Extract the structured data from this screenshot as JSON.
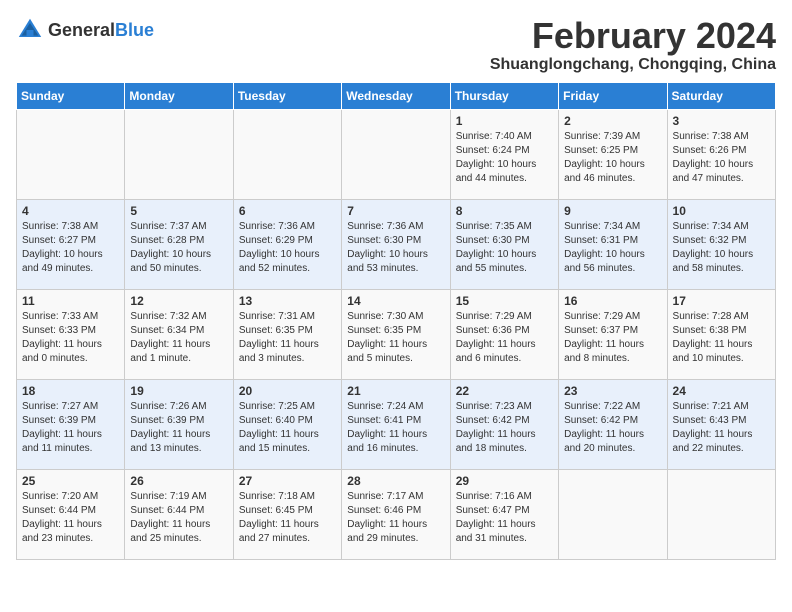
{
  "header": {
    "logo_general": "General",
    "logo_blue": "Blue",
    "title": "February 2024",
    "subtitle": "Shuanglongchang, Chongqing, China"
  },
  "days_of_week": [
    "Sunday",
    "Monday",
    "Tuesday",
    "Wednesday",
    "Thursday",
    "Friday",
    "Saturday"
  ],
  "weeks": [
    [
      {
        "day": "",
        "info": ""
      },
      {
        "day": "",
        "info": ""
      },
      {
        "day": "",
        "info": ""
      },
      {
        "day": "",
        "info": ""
      },
      {
        "day": "1",
        "info": "Sunrise: 7:40 AM\nSunset: 6:24 PM\nDaylight: 10 hours\nand 44 minutes."
      },
      {
        "day": "2",
        "info": "Sunrise: 7:39 AM\nSunset: 6:25 PM\nDaylight: 10 hours\nand 46 minutes."
      },
      {
        "day": "3",
        "info": "Sunrise: 7:38 AM\nSunset: 6:26 PM\nDaylight: 10 hours\nand 47 minutes."
      }
    ],
    [
      {
        "day": "4",
        "info": "Sunrise: 7:38 AM\nSunset: 6:27 PM\nDaylight: 10 hours\nand 49 minutes."
      },
      {
        "day": "5",
        "info": "Sunrise: 7:37 AM\nSunset: 6:28 PM\nDaylight: 10 hours\nand 50 minutes."
      },
      {
        "day": "6",
        "info": "Sunrise: 7:36 AM\nSunset: 6:29 PM\nDaylight: 10 hours\nand 52 minutes."
      },
      {
        "day": "7",
        "info": "Sunrise: 7:36 AM\nSunset: 6:30 PM\nDaylight: 10 hours\nand 53 minutes."
      },
      {
        "day": "8",
        "info": "Sunrise: 7:35 AM\nSunset: 6:30 PM\nDaylight: 10 hours\nand 55 minutes."
      },
      {
        "day": "9",
        "info": "Sunrise: 7:34 AM\nSunset: 6:31 PM\nDaylight: 10 hours\nand 56 minutes."
      },
      {
        "day": "10",
        "info": "Sunrise: 7:34 AM\nSunset: 6:32 PM\nDaylight: 10 hours\nand 58 minutes."
      }
    ],
    [
      {
        "day": "11",
        "info": "Sunrise: 7:33 AM\nSunset: 6:33 PM\nDaylight: 11 hours\nand 0 minutes."
      },
      {
        "day": "12",
        "info": "Sunrise: 7:32 AM\nSunset: 6:34 PM\nDaylight: 11 hours\nand 1 minute."
      },
      {
        "day": "13",
        "info": "Sunrise: 7:31 AM\nSunset: 6:35 PM\nDaylight: 11 hours\nand 3 minutes."
      },
      {
        "day": "14",
        "info": "Sunrise: 7:30 AM\nSunset: 6:35 PM\nDaylight: 11 hours\nand 5 minutes."
      },
      {
        "day": "15",
        "info": "Sunrise: 7:29 AM\nSunset: 6:36 PM\nDaylight: 11 hours\nand 6 minutes."
      },
      {
        "day": "16",
        "info": "Sunrise: 7:29 AM\nSunset: 6:37 PM\nDaylight: 11 hours\nand 8 minutes."
      },
      {
        "day": "17",
        "info": "Sunrise: 7:28 AM\nSunset: 6:38 PM\nDaylight: 11 hours\nand 10 minutes."
      }
    ],
    [
      {
        "day": "18",
        "info": "Sunrise: 7:27 AM\nSunset: 6:39 PM\nDaylight: 11 hours\nand 11 minutes."
      },
      {
        "day": "19",
        "info": "Sunrise: 7:26 AM\nSunset: 6:39 PM\nDaylight: 11 hours\nand 13 minutes."
      },
      {
        "day": "20",
        "info": "Sunrise: 7:25 AM\nSunset: 6:40 PM\nDaylight: 11 hours\nand 15 minutes."
      },
      {
        "day": "21",
        "info": "Sunrise: 7:24 AM\nSunset: 6:41 PM\nDaylight: 11 hours\nand 16 minutes."
      },
      {
        "day": "22",
        "info": "Sunrise: 7:23 AM\nSunset: 6:42 PM\nDaylight: 11 hours\nand 18 minutes."
      },
      {
        "day": "23",
        "info": "Sunrise: 7:22 AM\nSunset: 6:42 PM\nDaylight: 11 hours\nand 20 minutes."
      },
      {
        "day": "24",
        "info": "Sunrise: 7:21 AM\nSunset: 6:43 PM\nDaylight: 11 hours\nand 22 minutes."
      }
    ],
    [
      {
        "day": "25",
        "info": "Sunrise: 7:20 AM\nSunset: 6:44 PM\nDaylight: 11 hours\nand 23 minutes."
      },
      {
        "day": "26",
        "info": "Sunrise: 7:19 AM\nSunset: 6:44 PM\nDaylight: 11 hours\nand 25 minutes."
      },
      {
        "day": "27",
        "info": "Sunrise: 7:18 AM\nSunset: 6:45 PM\nDaylight: 11 hours\nand 27 minutes."
      },
      {
        "day": "28",
        "info": "Sunrise: 7:17 AM\nSunset: 6:46 PM\nDaylight: 11 hours\nand 29 minutes."
      },
      {
        "day": "29",
        "info": "Sunrise: 7:16 AM\nSunset: 6:47 PM\nDaylight: 11 hours\nand 31 minutes."
      },
      {
        "day": "",
        "info": ""
      },
      {
        "day": "",
        "info": ""
      }
    ]
  ]
}
